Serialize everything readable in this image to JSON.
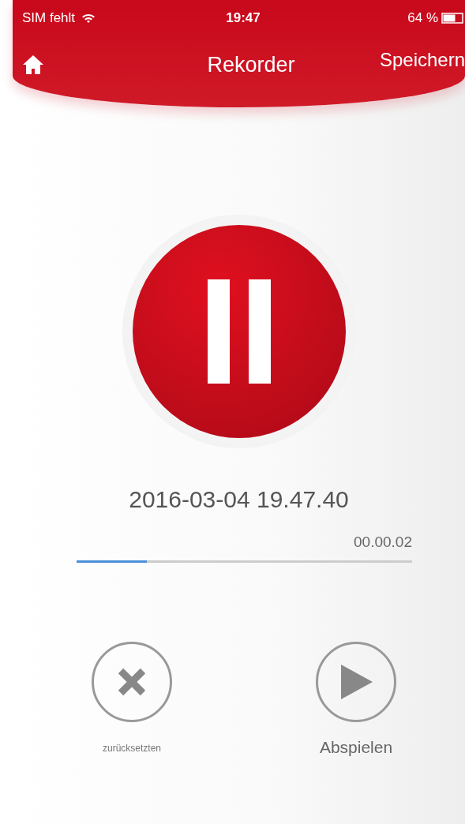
{
  "status_bar": {
    "carrier": "SIM fehlt",
    "time": "19:47",
    "battery": "64 %"
  },
  "nav": {
    "title": "Rekorder",
    "action": "Speichern"
  },
  "recorder": {
    "recording": true,
    "name": "2016-03-04 19.47.40",
    "elapsed": "00.00.02",
    "level": 0.21
  },
  "buttons": [
    {
      "kind": "reset",
      "label": "zurücksetzten"
    },
    {
      "kind": "play",
      "label": "Abspielen"
    }
  ]
}
